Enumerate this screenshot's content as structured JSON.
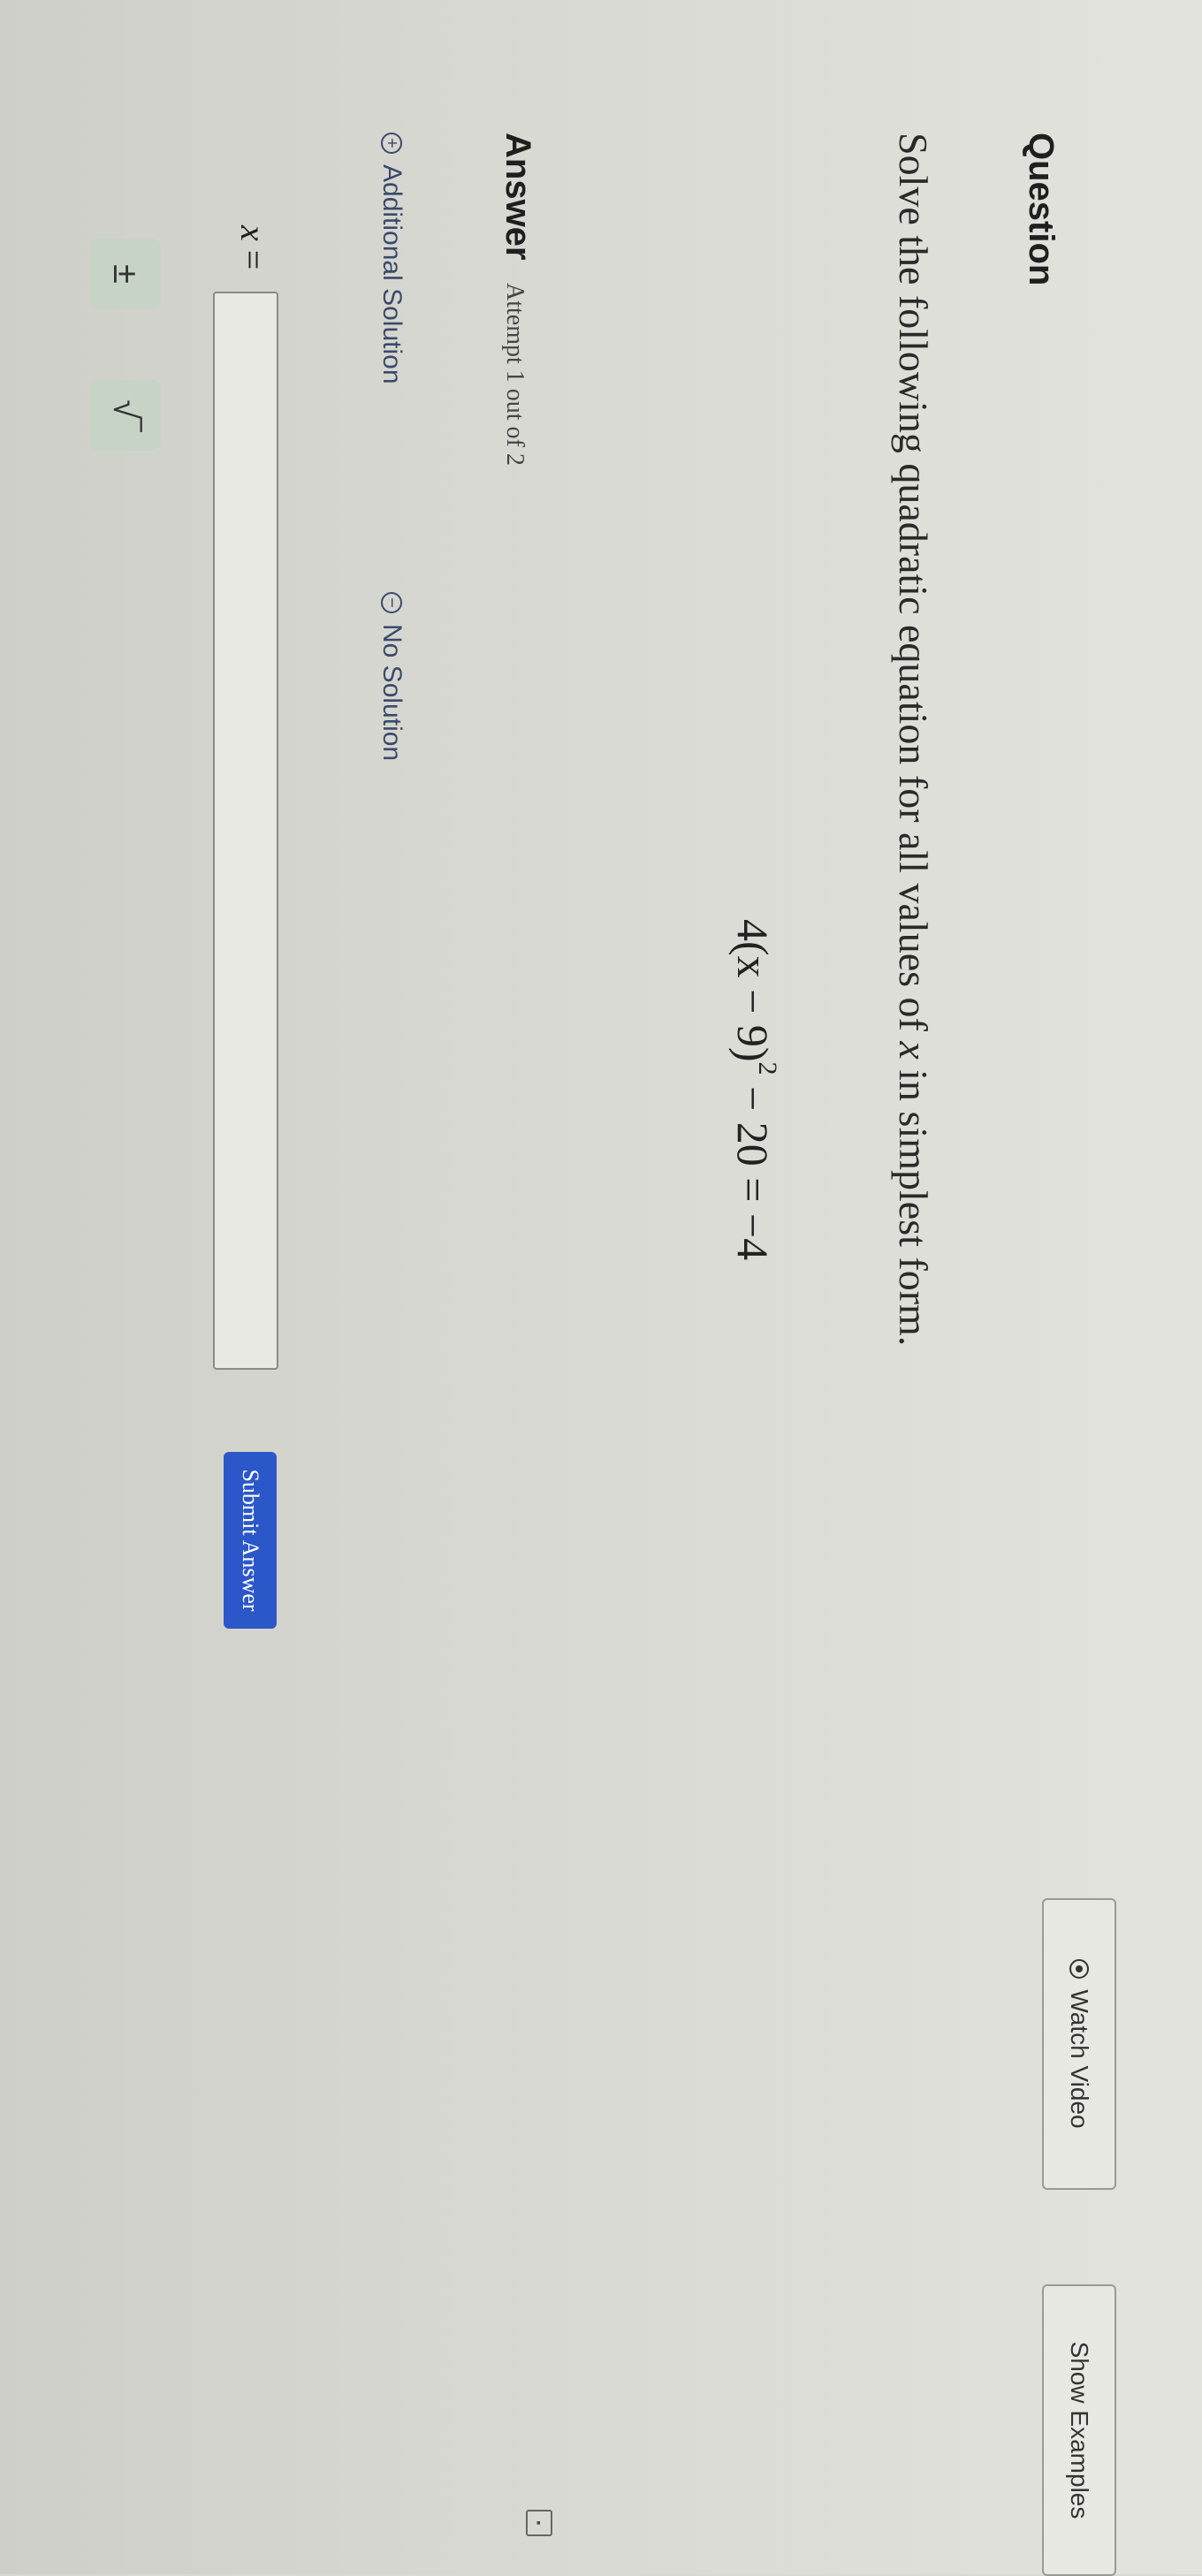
{
  "header": {
    "title": "Question",
    "watch_video_label": "Watch Video",
    "show_examples_label": "Show Examples"
  },
  "question": {
    "prompt_before": "Solve the following quadratic equation for all values of ",
    "prompt_var": "x",
    "prompt_after": " in simplest form.",
    "equation_main": "4(x − 9)",
    "equation_exp": "2",
    "equation_rest": " − 20 = −4"
  },
  "answer": {
    "label": "Answer",
    "attempt_text": "Attempt 1 out of 2",
    "additional_solution_label": "Additional Solution",
    "no_solution_label": "No Solution",
    "variable_label": "x",
    "equals": " =",
    "input_value": "",
    "submit_label": "Submit Answer"
  },
  "math_buttons": {
    "plus_minus": "±",
    "sqrt": "√‾"
  },
  "icons": {
    "watch_video": "play-circle-icon",
    "additional_solution": "plus-circle-icon",
    "no_solution": "minus-circle-icon",
    "corner": "calculator-icon"
  },
  "colors": {
    "submit_bg": "#2b57c9",
    "option_text": "#3a4a6a",
    "math_button_bg": "#c8d3c8"
  }
}
